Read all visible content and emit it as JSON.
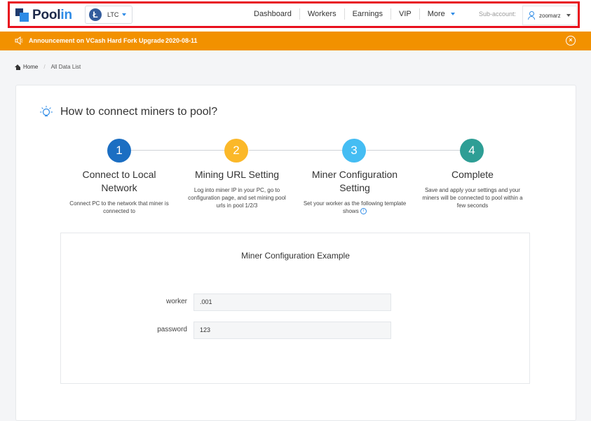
{
  "header": {
    "logo": {
      "text_main": "Pool",
      "text_accent": "in"
    },
    "coin": {
      "symbol": "Ł",
      "label": "LTC",
      "icon": "litecoin-icon"
    },
    "nav": [
      {
        "label": "Dashboard"
      },
      {
        "label": "Workers"
      },
      {
        "label": "Earnings"
      },
      {
        "label": "VIP"
      },
      {
        "label": "More"
      }
    ],
    "sub_account_label": "Sub-account:",
    "account_name": "zoomarz"
  },
  "announcement": {
    "text": "Announcement on VCash Hard Fork Upgrade",
    "date": "2020-08-11",
    "close": "×"
  },
  "breadcrumb": {
    "home": "Home",
    "separator": "/",
    "current": "All Data List"
  },
  "card": {
    "title": "How to connect miners to pool?",
    "steps": [
      {
        "number": "1",
        "title": "Connect to Local Network",
        "desc": "Connect PC to the network that miner is connected to"
      },
      {
        "number": "2",
        "title": "Mining URL Setting",
        "desc": "Log into miner IP in your PC, go to configuration page, and set mining pool urls in pool 1/2/3"
      },
      {
        "number": "3",
        "title": "Miner Configuration Setting",
        "desc": "Set your worker as the following template shows",
        "info": "i"
      },
      {
        "number": "4",
        "title": "Complete",
        "desc": "Save and apply your settings and your miners will be connected to pool within a few seconds"
      }
    ],
    "example": {
      "title": "Miner Configuration Example",
      "worker_label": "worker",
      "worker_value": ".001",
      "password_label": "password",
      "password_value": "123"
    }
  },
  "colors": {
    "brand": "#2e8be6",
    "announcement": "#f29100",
    "step1": "#1b6ec2",
    "step2": "#fbb829",
    "step3": "#45bdf3",
    "step4": "#2e9e95",
    "outline": "#e8101e"
  }
}
